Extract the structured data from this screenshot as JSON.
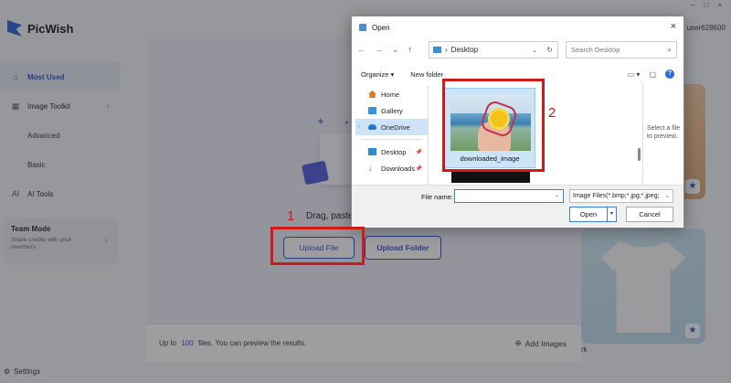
{
  "app": {
    "brand_name": "PicWish",
    "user_name": "user628600",
    "window_controls": [
      "–",
      "□",
      "×"
    ],
    "sidebar": {
      "most_used": "Most Used",
      "image_toolkit": "Image Toolkit",
      "advanced": "Advanced",
      "basic": "Basic",
      "ai_tools": "AI Tools",
      "team_mode_title": "Team Mode",
      "team_mode_desc": "Share credits with your members",
      "settings": "Settings"
    },
    "right_card_label": "rk"
  },
  "upload_modal": {
    "drag_text": "Drag, paste",
    "upload_file": "Upload File",
    "upload_folder": "Upload Folder",
    "footer_prefix": "Up to",
    "footer_count": "100",
    "footer_suffix": "files. You can preview the results.",
    "add_images": "Add Images"
  },
  "open_dialog": {
    "title": "Open",
    "close_glyph": "×",
    "path": "Desktop",
    "search_placeholder": "Search Desktop",
    "organize": "Organize ▾",
    "new_folder": "New folder",
    "nav_items": {
      "home": "Home",
      "gallery": "Gallery",
      "onedrive": "OneDrive",
      "desktop": "Desktop",
      "downloads": "Downloads"
    },
    "file_name_label": "downloaded_image",
    "preview_hint": "Select a file to preview.",
    "file_name_field_label": "File name:",
    "file_name_value": "",
    "file_type": "Image Files(*.bmp;*.jpg;*.jpeg;",
    "open_button": "Open",
    "cancel_button": "Cancel"
  },
  "annotations": {
    "step1": "1",
    "step2": "2",
    "color": "#d01a1a"
  }
}
